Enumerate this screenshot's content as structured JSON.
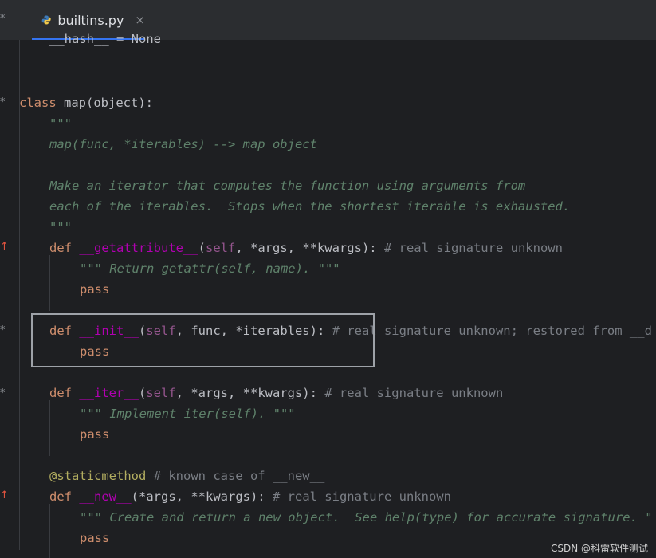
{
  "tab": {
    "filename": "builtins.py",
    "close": "×"
  },
  "code": {
    "l0": "__hash__ = None",
    "l1_kw": "class",
    "l1_rest": " map(object):",
    "l2": "\"\"\"",
    "l3": "map(func, *iterables) --> map object",
    "l4": "Make an iterator that computes the function using arguments from",
    "l5": "each of the iterables.  Stops when the shortest iterable is exhausted.",
    "l6": "\"\"\"",
    "getattr_def": "def",
    "getattr_name": "__getattribute__",
    "getattr_args_open": "(",
    "getattr_self": "self",
    "getattr_args": ", *args, **kwargs):",
    "getattr_cm": " # real signature unknown",
    "getattr_doc": "\"\"\" Return getattr(self, name). \"\"\"",
    "pass": "pass",
    "init_def": "def",
    "init_name": "__init__",
    "init_self": "self",
    "init_args": ", func, *iterables):",
    "init_cm": " # real signature unknown; restored from __d",
    "iter_def": "def",
    "iter_name": "__iter__",
    "iter_self": "self",
    "iter_args": ", *args, **kwargs):",
    "iter_cm": " # real signature unknown",
    "iter_doc": "\"\"\" Implement iter(self). \"\"\"",
    "deco": "@staticmethod",
    "deco_cm": " # known case of __new__",
    "new_def": "def",
    "new_name": "__new__",
    "new_args": "(*args, **kwargs):",
    "new_cm": " # real signature unknown",
    "new_doc": "\"\"\" Create and return a new object.  See help(type) for accurate signature. \""
  },
  "gutter": {
    "star": "*",
    "arrow": "↑"
  },
  "watermark": "CSDN @科雷软件测试",
  "colors": {
    "keyword": "#cf8e6d",
    "dunder": "#b200b2",
    "docstring": "#5f826b",
    "comment": "#7a7e85"
  },
  "icons": {
    "tab_icon": "python-icon"
  }
}
